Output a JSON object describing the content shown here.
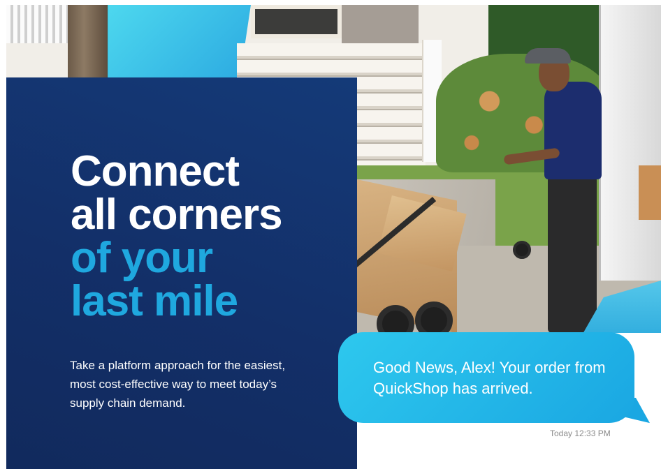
{
  "hero": {
    "headline": {
      "line1": "Connect",
      "line2": "all corners",
      "line3": "of your",
      "line4": "last mile"
    },
    "subtext": "Take a platform approach for the easiest, most cost-effective way to meet today’s supply chain demand."
  },
  "message": {
    "text": "Good News, Alex! Your order from QuickShop has arrived.",
    "timestamp": "Today 12:33 PM"
  },
  "colors": {
    "navy": "#132f68",
    "cyan_accent": "#1fa8df",
    "bubble": "#1aa7e2",
    "white": "#ffffff"
  }
}
